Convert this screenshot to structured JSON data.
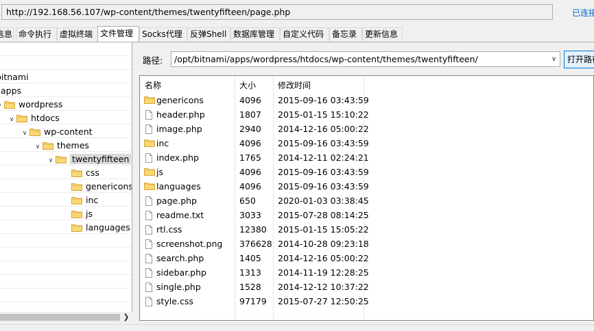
{
  "url": "http://192.168.56.107/wp-content/themes/twentyfifteen/page.php",
  "status": "已连接",
  "tabs": [
    "信息",
    "命令执行",
    "虚拟终端",
    "文件管理",
    "Socks代理",
    "反弹Shell",
    "数据库管理",
    "自定义代码",
    "备忘录",
    "更新信息"
  ],
  "active_tab": "文件管理",
  "tree": {
    "nodes": [
      {
        "label": "bitnami",
        "type": "root"
      },
      {
        "label": "apps",
        "type": "folder"
      },
      {
        "label": "wordpress",
        "type": "folder"
      },
      {
        "label": "htdocs",
        "type": "folder"
      },
      {
        "label": "wp-content",
        "type": "folder"
      },
      {
        "label": "themes",
        "type": "folder"
      },
      {
        "label": "twentyfifteen",
        "type": "folder",
        "selected": true
      },
      {
        "label": "css",
        "type": "folder"
      },
      {
        "label": "genericons",
        "type": "folder"
      },
      {
        "label": "inc",
        "type": "folder"
      },
      {
        "label": "js",
        "type": "folder"
      },
      {
        "label": "languages",
        "type": "folder"
      }
    ]
  },
  "path": {
    "label": "路径:",
    "value": "/opt/bitnami/apps/wordpress/htdocs/wp-content/themes/twentyfifteen/",
    "open_button": "打开路径"
  },
  "files": {
    "headers": {
      "name": "名称",
      "size": "大小",
      "modified": "修改时间"
    },
    "rows": [
      {
        "name": "genericons",
        "size": "4096",
        "modified": "2015-09-16 03:43:59",
        "type": "folder"
      },
      {
        "name": "header.php",
        "size": "1807",
        "modified": "2015-01-15 15:10:22",
        "type": "file"
      },
      {
        "name": "image.php",
        "size": "2940",
        "modified": "2014-12-16 05:00:22",
        "type": "file"
      },
      {
        "name": "inc",
        "size": "4096",
        "modified": "2015-09-16 03:43:59",
        "type": "folder"
      },
      {
        "name": "index.php",
        "size": "1765",
        "modified": "2014-12-11 02:24:21",
        "type": "file"
      },
      {
        "name": "js",
        "size": "4096",
        "modified": "2015-09-16 03:43:59",
        "type": "folder"
      },
      {
        "name": "languages",
        "size": "4096",
        "modified": "2015-09-16 03:43:59",
        "type": "folder"
      },
      {
        "name": "page.php",
        "size": "650",
        "modified": "2020-01-03 03:38:45",
        "type": "file"
      },
      {
        "name": "readme.txt",
        "size": "3033",
        "modified": "2015-07-28 08:14:25",
        "type": "file"
      },
      {
        "name": "rtl.css",
        "size": "12380",
        "modified": "2015-01-15 15:05:22",
        "type": "file"
      },
      {
        "name": "screenshot.png",
        "size": "376628",
        "modified": "2014-10-28 09:23:18",
        "type": "file"
      },
      {
        "name": "search.php",
        "size": "1405",
        "modified": "2014-12-16 05:00:22",
        "type": "file"
      },
      {
        "name": "sidebar.php",
        "size": "1313",
        "modified": "2014-11-19 12:28:25",
        "type": "file"
      },
      {
        "name": "single.php",
        "size": "1528",
        "modified": "2014-12-12 10:37:22",
        "type": "file"
      },
      {
        "name": "style.css",
        "size": "97179",
        "modified": "2015-07-27 12:50:25",
        "type": "file"
      }
    ]
  },
  "colors": {
    "link": "#0066cc",
    "folder": "#f5cd6a",
    "selection": "#d9d9d9"
  }
}
